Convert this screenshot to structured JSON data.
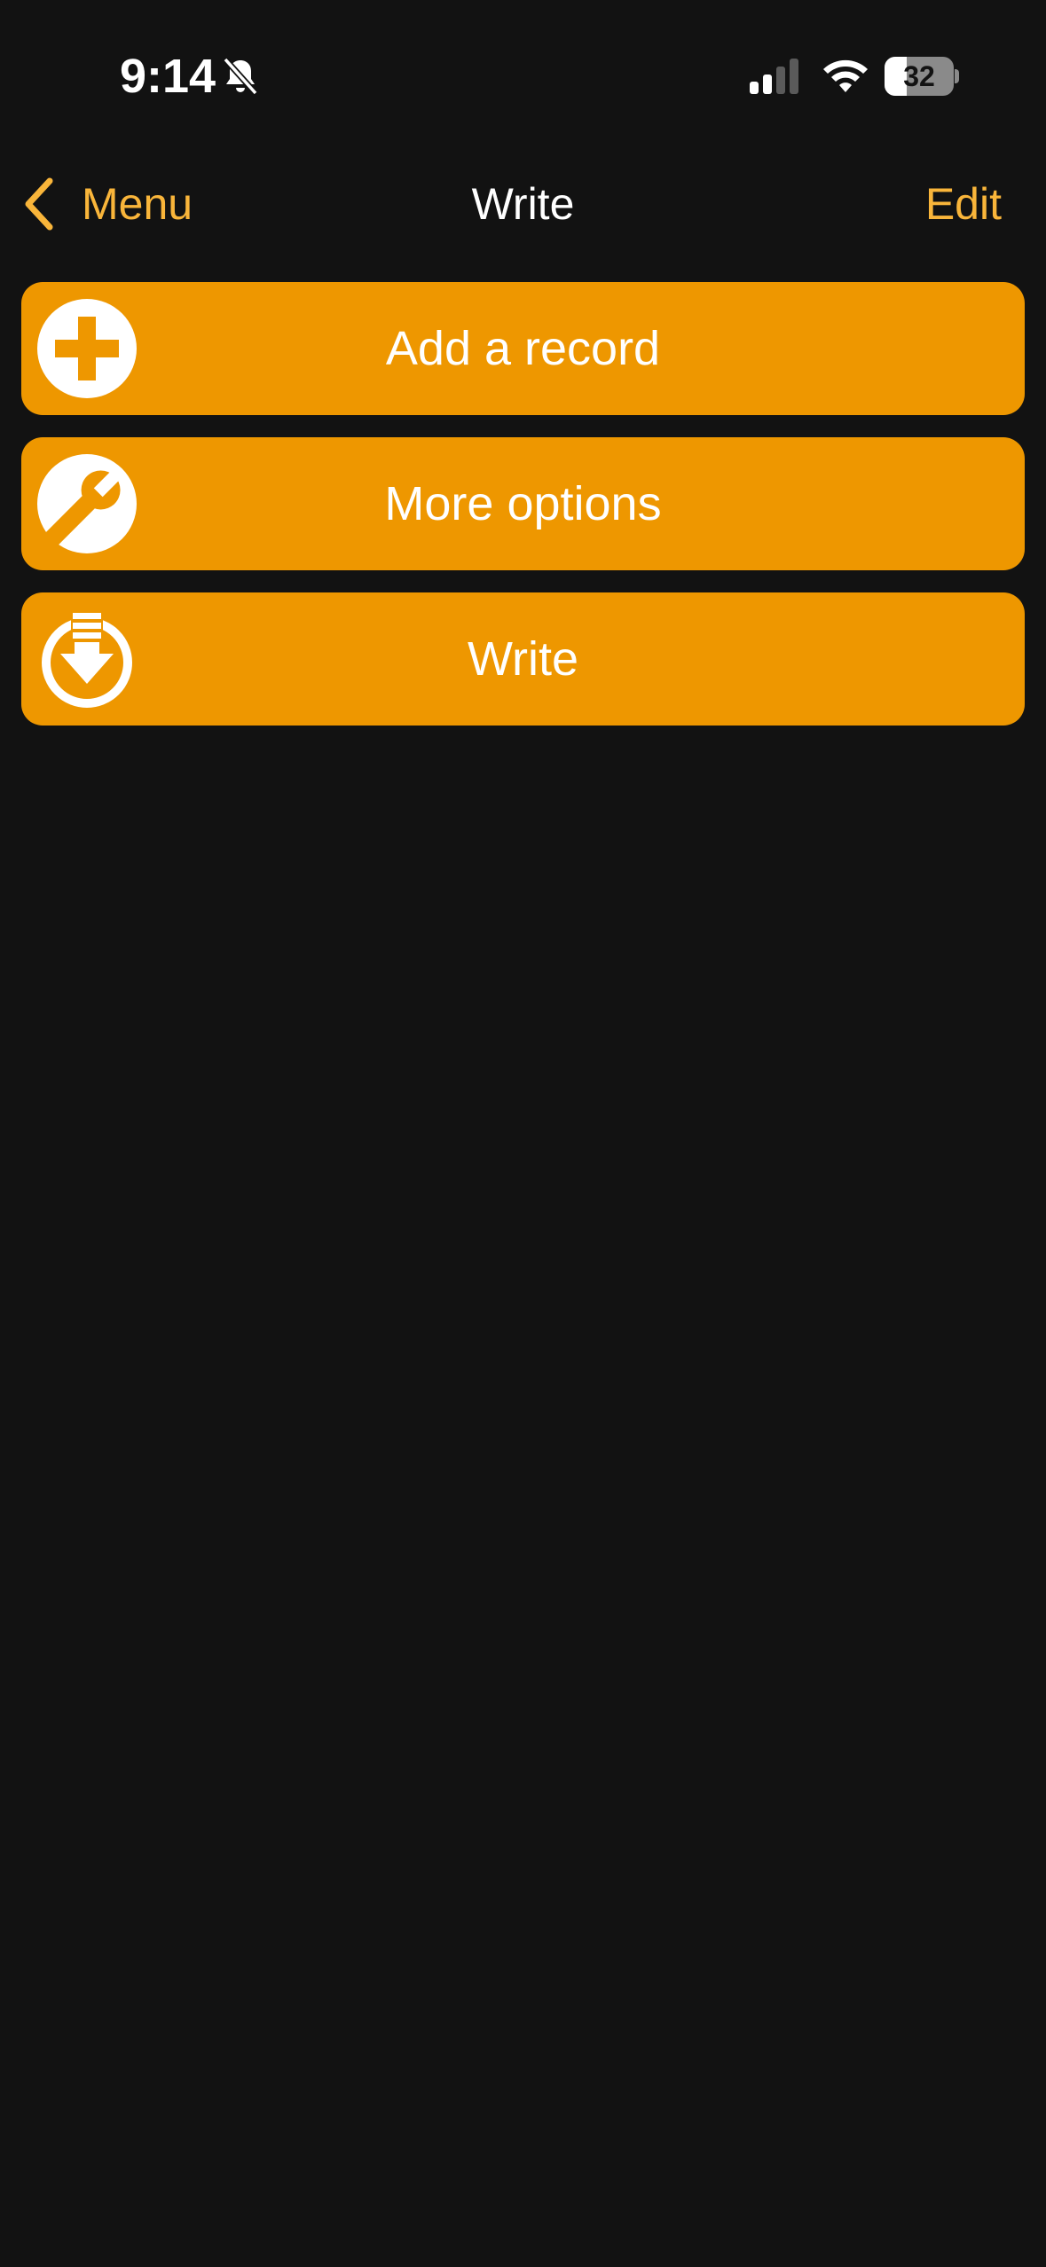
{
  "status_bar": {
    "time": "9:14",
    "silent_icon": "bell-slash-icon",
    "signal_icon": "cellular-signal-icon",
    "signal_bars": 2,
    "signal_bars_total": 4,
    "wifi_icon": "wifi-icon",
    "battery_icon": "battery-icon",
    "battery_level": "32"
  },
  "nav": {
    "back_icon": "chevron-left-icon",
    "back_label": "Menu",
    "title": "Write",
    "edit_label": "Edit"
  },
  "actions": [
    {
      "label": "Add a record",
      "icon": "plus-circle-icon"
    },
    {
      "label": "More options",
      "icon": "wrench-circle-icon"
    },
    {
      "label": "Write",
      "icon": "download-circle-icon"
    }
  ],
  "colors": {
    "background": "#121212",
    "accent": "#F9B53A",
    "button": "#EE9700",
    "text": "#FFFFFF"
  }
}
